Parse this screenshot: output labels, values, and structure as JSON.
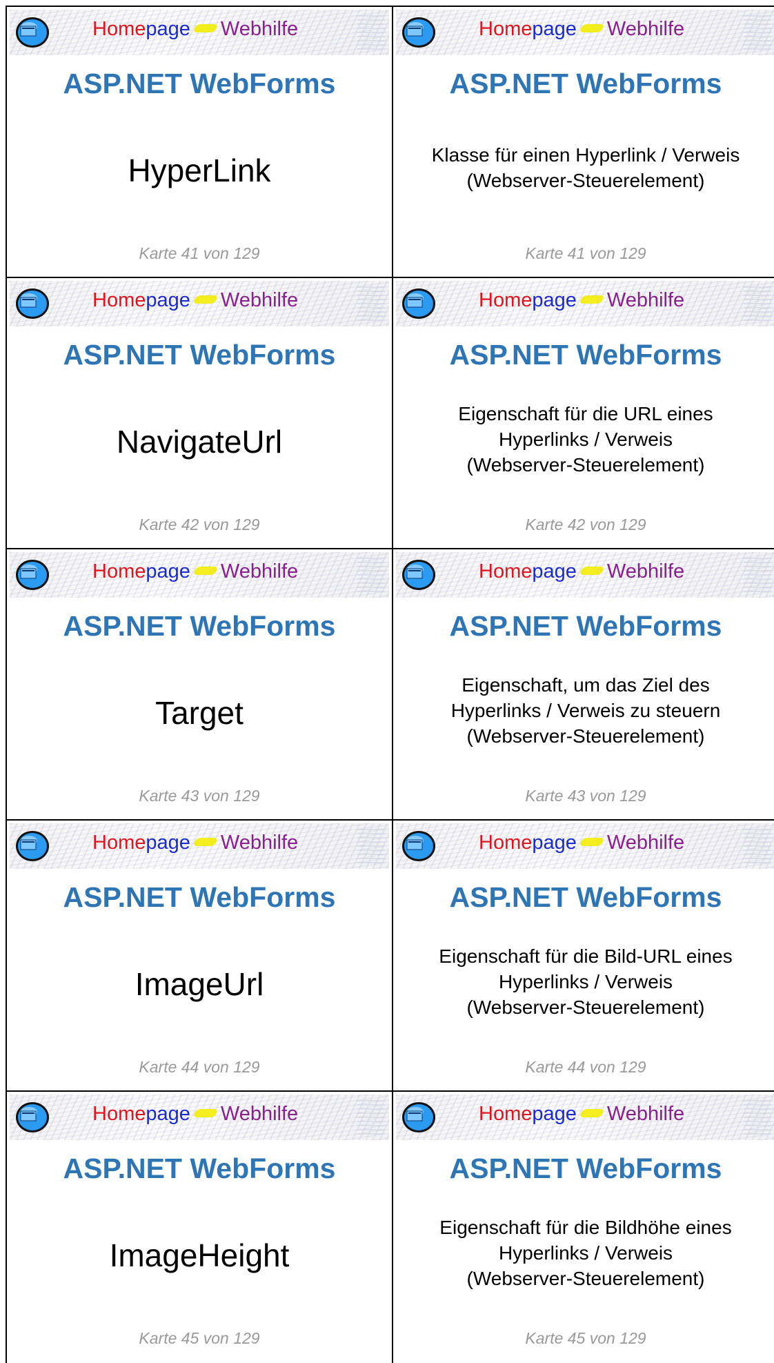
{
  "banner": {
    "home": "Home",
    "page": "page",
    "web": "Webhilfe"
  },
  "title": "ASP.NET WebForms",
  "cards": [
    {
      "term": "HyperLink",
      "counter": "Karte 41 von 129",
      "desc": [
        "Klasse für einen Hyperlink / Verweis",
        "(Webserver-Steuerelement)"
      ]
    },
    {
      "term": "NavigateUrl",
      "counter": "Karte 42 von 129",
      "desc": [
        "Eigenschaft für die URL eines",
        "Hyperlinks / Verweis",
        "(Webserver-Steuerelement)"
      ]
    },
    {
      "term": "Target",
      "counter": "Karte 43 von 129",
      "desc": [
        "Eigenschaft, um das Ziel des",
        "Hyperlinks / Verweis zu steuern",
        "(Webserver-Steuerelement)"
      ]
    },
    {
      "term": "ImageUrl",
      "counter": "Karte 44 von 129",
      "desc": [
        "Eigenschaft für die Bild-URL eines",
        "Hyperlinks / Verweis",
        "(Webserver-Steuerelement)"
      ]
    },
    {
      "term": "ImageHeight",
      "counter": "Karte 45 von 129",
      "desc": [
        "Eigenschaft für die Bildhöhe eines",
        "Hyperlinks / Verweis",
        "(Webserver-Steuerelement)"
      ]
    }
  ]
}
